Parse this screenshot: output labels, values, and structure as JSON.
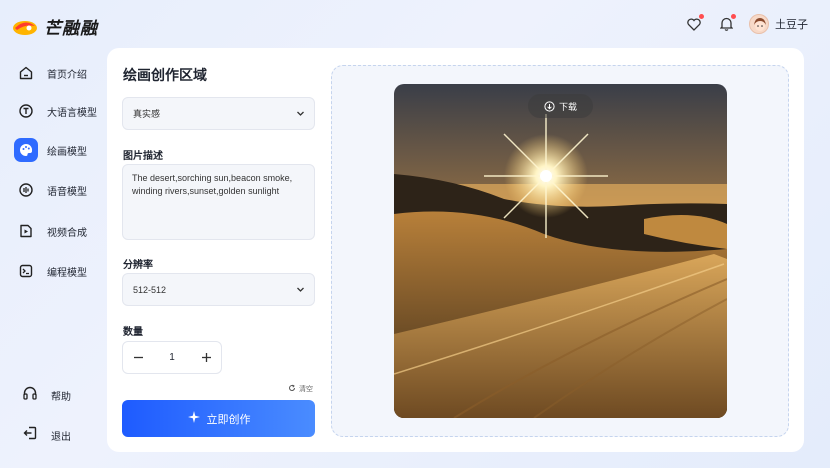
{
  "app": {
    "logo_text": "芒融融"
  },
  "header": {
    "favorites_icon": "heart-icon",
    "notifications_icon": "bell-icon",
    "username": "土豆子"
  },
  "sidebar": {
    "items": [
      {
        "label": "首页介绍",
        "icon": "home-icon",
        "active": false
      },
      {
        "label": "大语言模型",
        "icon": "llm-icon",
        "active": false
      },
      {
        "label": "绘画模型",
        "icon": "palette-icon",
        "active": true
      },
      {
        "label": "语音模型",
        "icon": "audio-icon",
        "active": false
      },
      {
        "label": "视频合成",
        "icon": "video-icon",
        "active": false
      },
      {
        "label": "编程模型",
        "icon": "terminal-icon",
        "active": false
      }
    ],
    "help_label": "帮助",
    "logout_label": "退出"
  },
  "form": {
    "title": "绘画创作区域",
    "style_value": "真实感",
    "description_label": "图片描述",
    "description_value": "The desert,sorching sun,beacon smoke, winding rivers,sunset,golden sunlight",
    "resolution_label": "分辨率",
    "resolution_value": "512-512",
    "quantity_label": "数量",
    "quantity_value": "1",
    "clear_label": "清空",
    "create_label": "立即创作"
  },
  "preview": {
    "download_label": "下载"
  },
  "colors": {
    "accent": "#2f6bff",
    "badge": "#ff4d4f"
  }
}
